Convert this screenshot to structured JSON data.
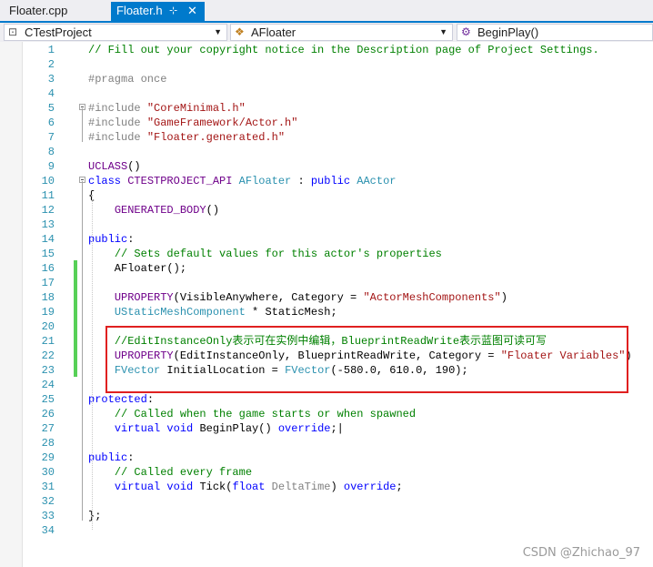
{
  "tabs": [
    {
      "label": "Floater.cpp",
      "active": false
    },
    {
      "label": "Floater.h",
      "active": true,
      "pin_icon": "pin-icon",
      "close_icon": "close-icon"
    }
  ],
  "nav": {
    "project": "CTestProject",
    "class": "AFloater",
    "member": "BeginPlay()"
  },
  "colors": {
    "accent": "#007acc",
    "comment": "#008000",
    "keyword": "#0000ff",
    "type": "#2b91af",
    "string": "#a31515",
    "macro": "#6f008a",
    "highlight_box": "#e02020",
    "change_bar": "#57d057"
  },
  "code_lines": [
    {
      "n": "1",
      "segs": [
        {
          "c": "c",
          "t": "// Fill out your copyright notice in the Description page of Project Settings."
        }
      ]
    },
    {
      "n": "2",
      "segs": []
    },
    {
      "n": "3",
      "segs": [
        {
          "c": "pr",
          "t": "#pragma once"
        }
      ]
    },
    {
      "n": "4",
      "segs": []
    },
    {
      "n": "5",
      "segs": [
        {
          "c": "pr",
          "t": "#include "
        },
        {
          "c": "s",
          "t": "\"CoreMinimal.h\""
        }
      ]
    },
    {
      "n": "6",
      "segs": [
        {
          "c": "pr",
          "t": "#include "
        },
        {
          "c": "s",
          "t": "\"GameFramework/Actor.h\""
        }
      ]
    },
    {
      "n": "7",
      "segs": [
        {
          "c": "pr",
          "t": "#include "
        },
        {
          "c": "s",
          "t": "\"Floater.generated.h\""
        }
      ]
    },
    {
      "n": "8",
      "segs": []
    },
    {
      "n": "9",
      "segs": [
        {
          "c": "m",
          "t": "UCLASS"
        },
        {
          "c": "",
          "t": "()"
        }
      ]
    },
    {
      "n": "10",
      "segs": [
        {
          "c": "k",
          "t": "class "
        },
        {
          "c": "m",
          "t": "CTESTPROJECT_API "
        },
        {
          "c": "t",
          "t": "AFloater"
        },
        {
          "c": "",
          "t": " : "
        },
        {
          "c": "k",
          "t": "public "
        },
        {
          "c": "t",
          "t": "AActor"
        }
      ]
    },
    {
      "n": "11",
      "segs": [
        {
          "c": "",
          "t": "{"
        }
      ]
    },
    {
      "n": "12",
      "segs": [
        {
          "c": "",
          "t": "    "
        },
        {
          "c": "m",
          "t": "GENERATED_BODY"
        },
        {
          "c": "",
          "t": "()"
        }
      ]
    },
    {
      "n": "13",
      "segs": []
    },
    {
      "n": "14",
      "segs": [
        {
          "c": "k",
          "t": "public"
        },
        {
          "c": "",
          "t": ":"
        }
      ]
    },
    {
      "n": "15",
      "segs": [
        {
          "c": "",
          "t": "    "
        },
        {
          "c": "c",
          "t": "// Sets default values for this actor's properties"
        }
      ]
    },
    {
      "n": "16",
      "segs": [
        {
          "c": "",
          "t": "    AFloater();"
        }
      ]
    },
    {
      "n": "17",
      "segs": []
    },
    {
      "n": "18",
      "segs": [
        {
          "c": "",
          "t": "    "
        },
        {
          "c": "m",
          "t": "UPROPERTY"
        },
        {
          "c": "",
          "t": "(VisibleAnywhere, Category = "
        },
        {
          "c": "s",
          "t": "\"ActorMeshComponents\""
        },
        {
          "c": "",
          "t": ")"
        }
      ]
    },
    {
      "n": "19",
      "segs": [
        {
          "c": "",
          "t": "    "
        },
        {
          "c": "t",
          "t": "UStaticMeshComponent"
        },
        {
          "c": "",
          "t": " * StaticMesh;"
        }
      ]
    },
    {
      "n": "20",
      "segs": []
    },
    {
      "n": "21",
      "segs": [
        {
          "c": "",
          "t": "    "
        },
        {
          "c": "c",
          "t": "//EditInstanceOnly表示可在实例中编辑，BlueprintReadWrite表示蓝图可读可写"
        }
      ]
    },
    {
      "n": "22",
      "segs": [
        {
          "c": "",
          "t": "    "
        },
        {
          "c": "m",
          "t": "UPROPERTY"
        },
        {
          "c": "",
          "t": "(EditInstanceOnly, BlueprintReadWrite, Category = "
        },
        {
          "c": "s",
          "t": "\"Floater Variables\""
        },
        {
          "c": "",
          "t": ")"
        }
      ]
    },
    {
      "n": "23",
      "segs": [
        {
          "c": "",
          "t": "    "
        },
        {
          "c": "t",
          "t": "FVector"
        },
        {
          "c": "",
          "t": " InitialLocation = "
        },
        {
          "c": "t",
          "t": "FVector"
        },
        {
          "c": "",
          "t": "(-580.0, 610.0, 190);"
        }
      ]
    },
    {
      "n": "24",
      "segs": []
    },
    {
      "n": "25",
      "segs": [
        {
          "c": "k",
          "t": "protected"
        },
        {
          "c": "",
          "t": ":"
        }
      ]
    },
    {
      "n": "26",
      "segs": [
        {
          "c": "",
          "t": "    "
        },
        {
          "c": "c",
          "t": "// Called when the game starts or when spawned"
        }
      ]
    },
    {
      "n": "27",
      "segs": [
        {
          "c": "",
          "t": "    "
        },
        {
          "c": "k",
          "t": "virtual void "
        },
        {
          "c": "",
          "t": "BeginPlay() "
        },
        {
          "c": "k",
          "t": "override"
        },
        {
          "c": "",
          "t": ";|"
        }
      ]
    },
    {
      "n": "28",
      "segs": []
    },
    {
      "n": "29",
      "segs": [
        {
          "c": "k",
          "t": "public"
        },
        {
          "c": "",
          "t": ":"
        }
      ]
    },
    {
      "n": "30",
      "segs": [
        {
          "c": "",
          "t": "    "
        },
        {
          "c": "c",
          "t": "// Called every frame"
        }
      ]
    },
    {
      "n": "31",
      "segs": [
        {
          "c": "",
          "t": "    "
        },
        {
          "c": "k",
          "t": "virtual void "
        },
        {
          "c": "",
          "t": "Tick("
        },
        {
          "c": "k",
          "t": "float "
        },
        {
          "c": "p",
          "t": "DeltaTime"
        },
        {
          "c": "",
          "t": ") "
        },
        {
          "c": "k",
          "t": "override"
        },
        {
          "c": "",
          "t": ";"
        }
      ]
    },
    {
      "n": "32",
      "segs": []
    },
    {
      "n": "33",
      "segs": [
        {
          "c": "",
          "t": "};"
        }
      ]
    },
    {
      "n": "34",
      "segs": []
    }
  ],
  "watermark": "CSDN @Zhichao_97"
}
